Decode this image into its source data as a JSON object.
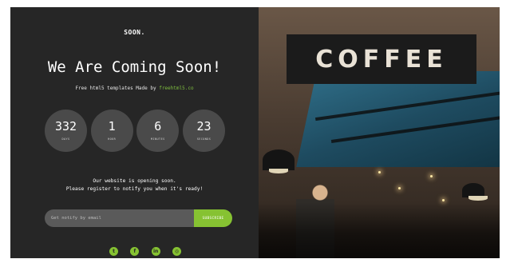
{
  "brand": "SOON.",
  "title": "We Are Coming Soon!",
  "subtitle": {
    "text": "Free html5 templates Made by ",
    "link": "freehtml5.co"
  },
  "countdown": [
    {
      "value": "332",
      "label": "DAYS"
    },
    {
      "value": "1",
      "label": "HOUR"
    },
    {
      "value": "6",
      "label": "MINUTES"
    },
    {
      "value": "23",
      "label": "SECONDS"
    }
  ],
  "message": {
    "line1": "Our website is opening soon.",
    "line2": "Please register to notify you when it's ready!"
  },
  "subscribe": {
    "placeholder": "Get notify by email",
    "button": "SUBSCRIBE"
  },
  "social": [
    {
      "icon": "twitter-icon",
      "glyph": "t"
    },
    {
      "icon": "facebook-icon",
      "glyph": "f"
    },
    {
      "icon": "linkedin-icon",
      "glyph": "in"
    },
    {
      "icon": "dribbble-icon",
      "glyph": "◎"
    }
  ],
  "hero_image": {
    "sign_text": "COFFEE"
  },
  "colors": {
    "panel_bg": "#262626",
    "accent": "#86c232",
    "circle_bg": "#4a4a4a"
  }
}
